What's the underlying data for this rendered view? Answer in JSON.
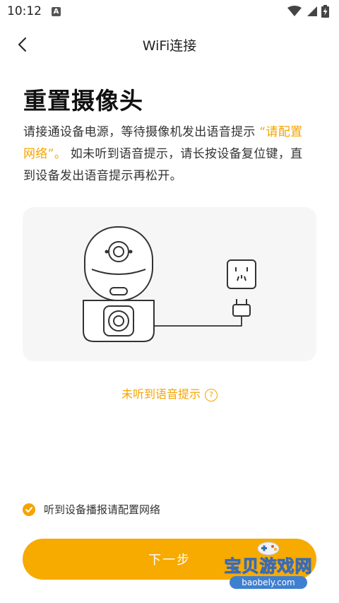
{
  "status_bar": {
    "time": "10:12",
    "notification_badge": "A",
    "icons": [
      "wifi-icon",
      "signal-icon",
      "battery-charging-icon"
    ]
  },
  "header": {
    "title": "WiFi连接",
    "back_icon": "chevron-left-icon"
  },
  "main": {
    "headline": "重置摄像头",
    "description_part1": "请接通设备电源，等待摄像机发出语音提示 ",
    "description_highlight": "“请配置网络”。",
    "description_part2": " 如未听到语音提示，请长按设备复位键，直到设备发出语音提示再松开。",
    "illustration": "camera-plugged-into-socket",
    "not_heard_link": "未听到语音提示",
    "not_heard_icon": "question-circle-icon"
  },
  "footer": {
    "confirm_label": "听到设备播报请配置网络",
    "confirm_checked": true,
    "next_button": "下一步"
  },
  "watermark": {
    "text": "宝贝游戏网",
    "url": "baobely.com"
  },
  "colors": {
    "accent": "#F5A400",
    "button": "#F7AA00",
    "illustration_bg": "#F6F6F7"
  }
}
